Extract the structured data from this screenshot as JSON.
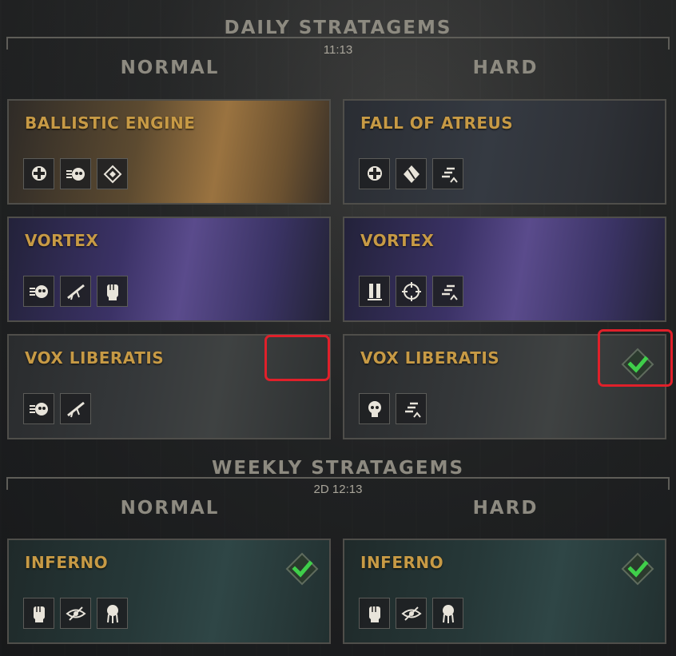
{
  "daily": {
    "title": "DAILY STRATAGEMS",
    "timer": "11:13",
    "normal_label": "NORMAL",
    "hard_label": "HARD",
    "normal": [
      {
        "name": "BALLISTIC ENGINE",
        "icons": [
          "cross-skull-icon",
          "speed-skull-icon",
          "diamond-target-icon"
        ],
        "completed": false
      },
      {
        "name": "VORTEX",
        "icons": [
          "speed-skull-icon",
          "sniper-rifle-icon",
          "fist-icon"
        ],
        "completed": false
      },
      {
        "name": "VOX LIBERATIS",
        "icons": [
          "speed-skull-icon",
          "sniper-rifle-icon"
        ],
        "completed": false
      }
    ],
    "hard": [
      {
        "name": "FALL OF ATREUS",
        "icons": [
          "cross-skull-icon",
          "melee-icon",
          "stairs-up-icon"
        ],
        "completed": false
      },
      {
        "name": "VORTEX",
        "icons": [
          "pillars-icon",
          "crosshair-icon",
          "stairs-up-icon"
        ],
        "completed": false
      },
      {
        "name": "VOX LIBERATIS",
        "icons": [
          "skull-icon",
          "stairs-up-icon"
        ],
        "completed": true
      }
    ]
  },
  "weekly": {
    "title": "WEEKLY STRATAGEMS",
    "timer": "2D 12:13",
    "normal_label": "NORMAL",
    "hard_label": "HARD",
    "normal": [
      {
        "name": "INFERNO",
        "icons": [
          "fist-icon",
          "hidden-eye-icon",
          "tentacle-head-icon"
        ],
        "completed": true
      }
    ],
    "hard": [
      {
        "name": "INFERNO",
        "icons": [
          "fist-icon",
          "hidden-eye-icon",
          "tentacle-head-icon"
        ],
        "completed": true
      }
    ]
  },
  "colors": {
    "card_title": "#c79a45",
    "check_green": "#3fcf4a",
    "highlight_red": "#e0202a"
  }
}
